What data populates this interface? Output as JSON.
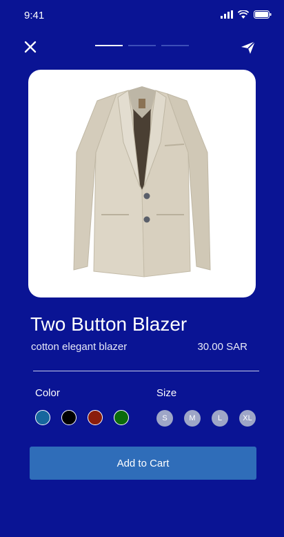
{
  "status_bar": {
    "time": "9:41"
  },
  "header": {
    "close_icon": "close-icon",
    "share_icon": "send-icon",
    "pager": {
      "count": 3,
      "active_index": 0
    }
  },
  "product": {
    "title": "Two Button Blazer",
    "subtitle": "cotton elegant blazer",
    "price": "30.00 SAR",
    "image": "beige blazer"
  },
  "options": {
    "color_label": "Color",
    "size_label": "Size",
    "colors": [
      "#17669e",
      "#000000",
      "#8a1d0c",
      "#0b6b0b"
    ],
    "sizes": [
      "S",
      "M",
      "L",
      "XL"
    ]
  },
  "actions": {
    "add_to_cart_label": "Add to Cart"
  },
  "theme": {
    "background": "#0a1494",
    "button": "#2f6db9",
    "size_chip": "#9ea6c7"
  }
}
